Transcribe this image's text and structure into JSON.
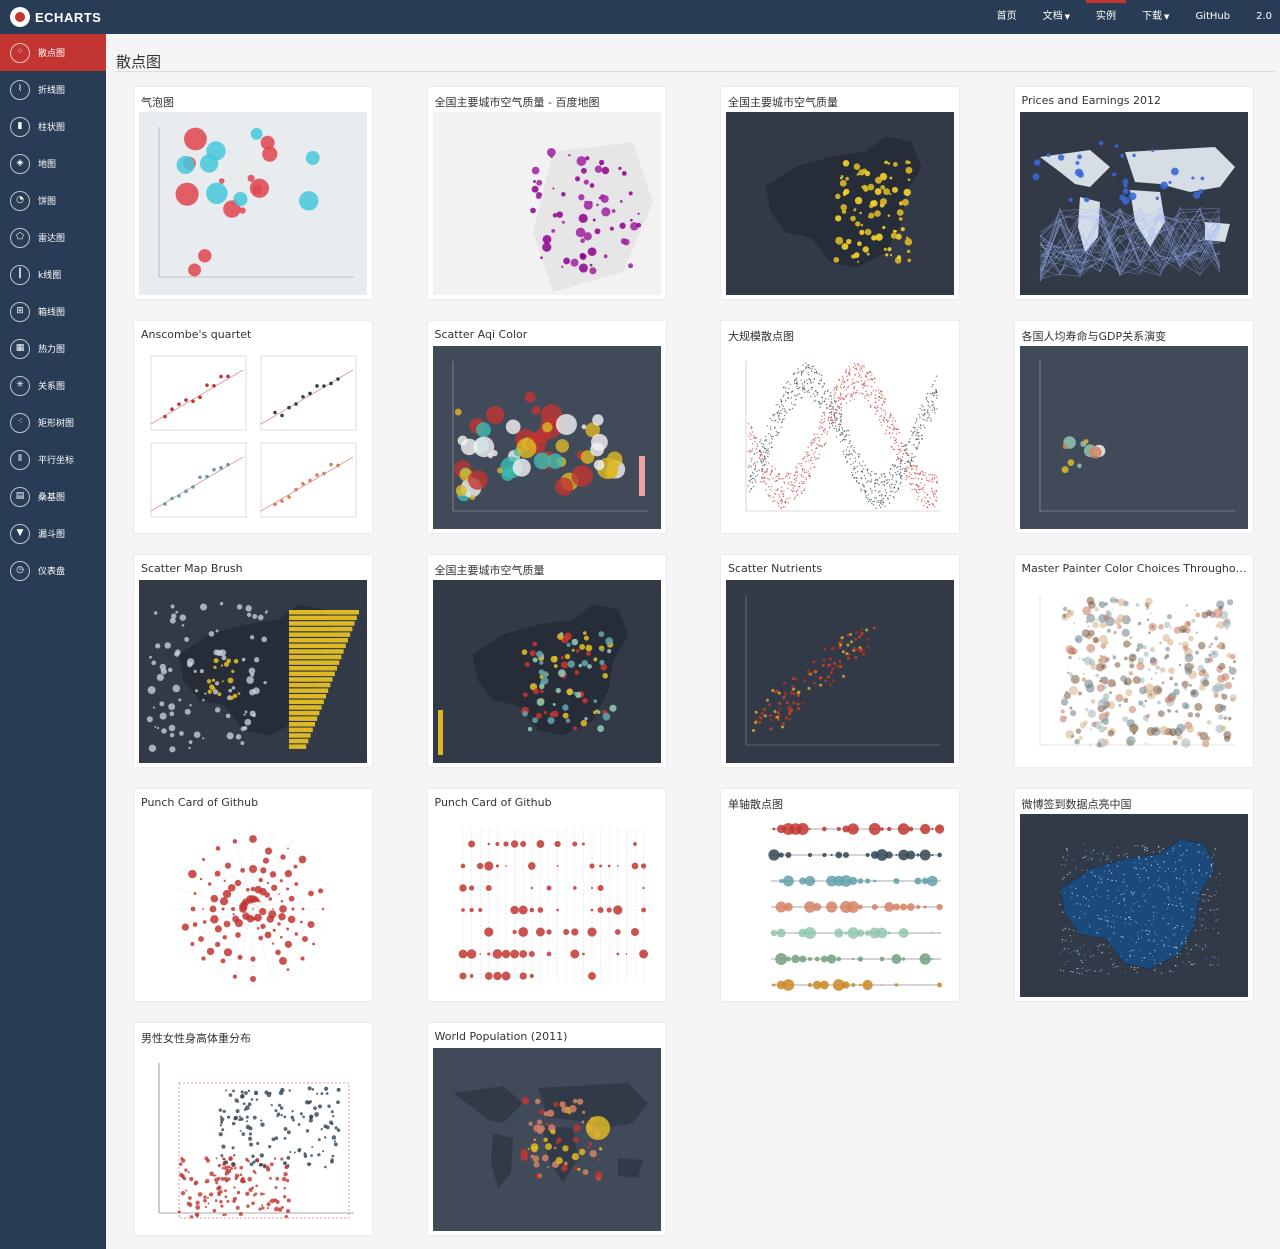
{
  "app": {
    "logo_text": "ECHARTS"
  },
  "nav": {
    "home": "首页",
    "docs": "文档",
    "examples": "实例",
    "download": "下载",
    "github": "GitHub",
    "version": "2.0"
  },
  "sidebar": {
    "items": [
      {
        "label": "散点图",
        "icon": "scatter-icon",
        "glyph": "⁘"
      },
      {
        "label": "折线图",
        "icon": "line-chart-icon",
        "glyph": "⌇"
      },
      {
        "label": "柱状图",
        "icon": "bar-chart-icon",
        "glyph": "▮"
      },
      {
        "label": "地图",
        "icon": "map-icon",
        "glyph": "◈"
      },
      {
        "label": "饼图",
        "icon": "pie-chart-icon",
        "glyph": "◔"
      },
      {
        "label": "雷达图",
        "icon": "radar-icon",
        "glyph": "⬠"
      },
      {
        "label": "k线图",
        "icon": "candlestick-icon",
        "glyph": "┃"
      },
      {
        "label": "箱线图",
        "icon": "boxplot-icon",
        "glyph": "⊞"
      },
      {
        "label": "热力图",
        "icon": "heatmap-icon",
        "glyph": "▦"
      },
      {
        "label": "关系图",
        "icon": "graph-icon",
        "glyph": "✳"
      },
      {
        "label": "矩形树图",
        "icon": "treemap-icon",
        "glyph": "⁖"
      },
      {
        "label": "平行坐标",
        "icon": "parallel-icon",
        "glyph": "⦀"
      },
      {
        "label": "桑基图",
        "icon": "sankey-icon",
        "glyph": "▤"
      },
      {
        "label": "漏斗图",
        "icon": "funnel-icon",
        "glyph": "▼"
      },
      {
        "label": "仪表盘",
        "icon": "gauge-icon",
        "glyph": "◷"
      }
    ]
  },
  "page": {
    "title": "散点图"
  },
  "cards": [
    {
      "title": "气泡图"
    },
    {
      "title": "全国主要城市空气质量 - 百度地图"
    },
    {
      "title": "全国主要城市空气质量"
    },
    {
      "title": "Prices and Earnings 2012"
    },
    {
      "title": "Anscombe's quartet"
    },
    {
      "title": "Scatter Aqi Color"
    },
    {
      "title": "大规模散点图"
    },
    {
      "title": "各国人均寿命与GDP关系演变"
    },
    {
      "title": "Scatter Map Brush"
    },
    {
      "title": "全国主要城市空气质量"
    },
    {
      "title": "Scatter Nutrients"
    },
    {
      "title": "Master Painter Color Choices Throughout..."
    },
    {
      "title": "Punch Card of Github"
    },
    {
      "title": "Punch Card of Github"
    },
    {
      "title": "单轴散点图"
    },
    {
      "title": "微博签到数据点亮中国"
    },
    {
      "title": "男性女性身高体重分布"
    },
    {
      "title": "World Population (2011)"
    }
  ],
  "colors": {
    "nav_bg": "#293c55",
    "accent": "#c23531",
    "dark_thumb": "#323a48"
  }
}
